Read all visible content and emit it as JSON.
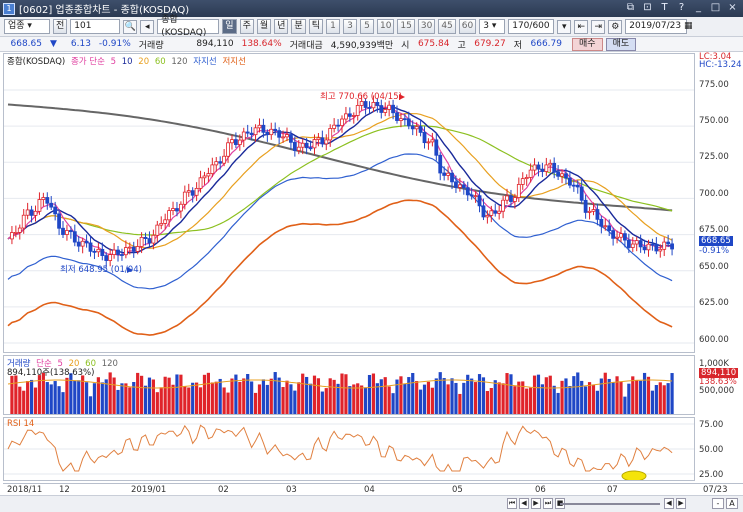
{
  "window": {
    "title": "[0602] 업종종합차트 - 종합(KOSDAQ)",
    "controls": [
      "⧉",
      "⊡",
      "T",
      "?",
      "_",
      "□",
      "×"
    ]
  },
  "toolbar": {
    "market_select": "업종",
    "code_prefix": "전",
    "code": "101",
    "name": "종합(KOSDAQ)",
    "period_buttons": [
      "일",
      "주",
      "월",
      "년",
      "분",
      "틱"
    ],
    "minute_buttons": [
      "1",
      "3",
      "5",
      "10",
      "15",
      "30",
      "45",
      "60"
    ],
    "interval_value": "3",
    "count": "170/600",
    "date": "2019/07/23"
  },
  "quote": {
    "price": "668.65",
    "change": "▼",
    "change_value": "6.13",
    "change_pct": "-0.91%",
    "volume_label": "거래량",
    "volume": "894,110",
    "volume_pct": "138.64%",
    "amount_label": "거래대금",
    "amount": "4,590,939백만",
    "open_label": "시",
    "open": "675.84",
    "high_label": "고",
    "high": "679.27",
    "low_label": "저",
    "low": "666.79",
    "buy_label": "매수",
    "sell_label": "매도"
  },
  "price_pane": {
    "legend": {
      "name": "종합(KOSDAQ)",
      "ma_label": "종가 단순",
      "ma_periods": [
        "5",
        "10",
        "20",
        "60",
        "120"
      ],
      "env1": "자지선",
      "env2": "저지선"
    },
    "annotations": {
      "high": "최고 770.66 (04/15)",
      "low": "최저 648.95 (01/04)"
    },
    "ticks": [
      "775.00",
      "750.00",
      "725.00",
      "700.00",
      "675.00",
      "650.00",
      "625.00",
      "600.00"
    ],
    "lc": "LC:3.04",
    "hc": "HC:-13.24",
    "last_price": "668.65",
    "last_pct": "-0.91%"
  },
  "volume_pane": {
    "legend_label": "거래량",
    "legend_ma": "단순",
    "legend_periods": [
      "5",
      "20",
      "60",
      "120"
    ],
    "legend_value": "894,110주(138.63%)",
    "ticks": [
      "1,000K",
      "500,000"
    ],
    "last_value": "894,110",
    "last_pct": "138.63%"
  },
  "rsi_pane": {
    "legend": "RSI 14",
    "ticks": [
      "75.00",
      "50.00",
      "25.00"
    ]
  },
  "x_axis": [
    "2018/11",
    "12",
    "2019/01",
    "02",
    "03",
    "04",
    "05",
    "06",
    "07",
    "07/23"
  ],
  "bottom_nav": [
    "⏮",
    "◀",
    "▶",
    "⏭",
    "■",
    "◀",
    "▶"
  ],
  "zoom": [
    "-",
    "A"
  ],
  "colors": {
    "up": "#e0232a",
    "down": "#1f47c6",
    "ma5": "#e040a0",
    "ma10": "#1a2a9a",
    "ma20": "#e8a020",
    "ma60": "#8cc020",
    "ma120": "#666666",
    "env_upper": "#e06018",
    "env_lower": "#3060d0",
    "rsi": "#e08040"
  }
}
